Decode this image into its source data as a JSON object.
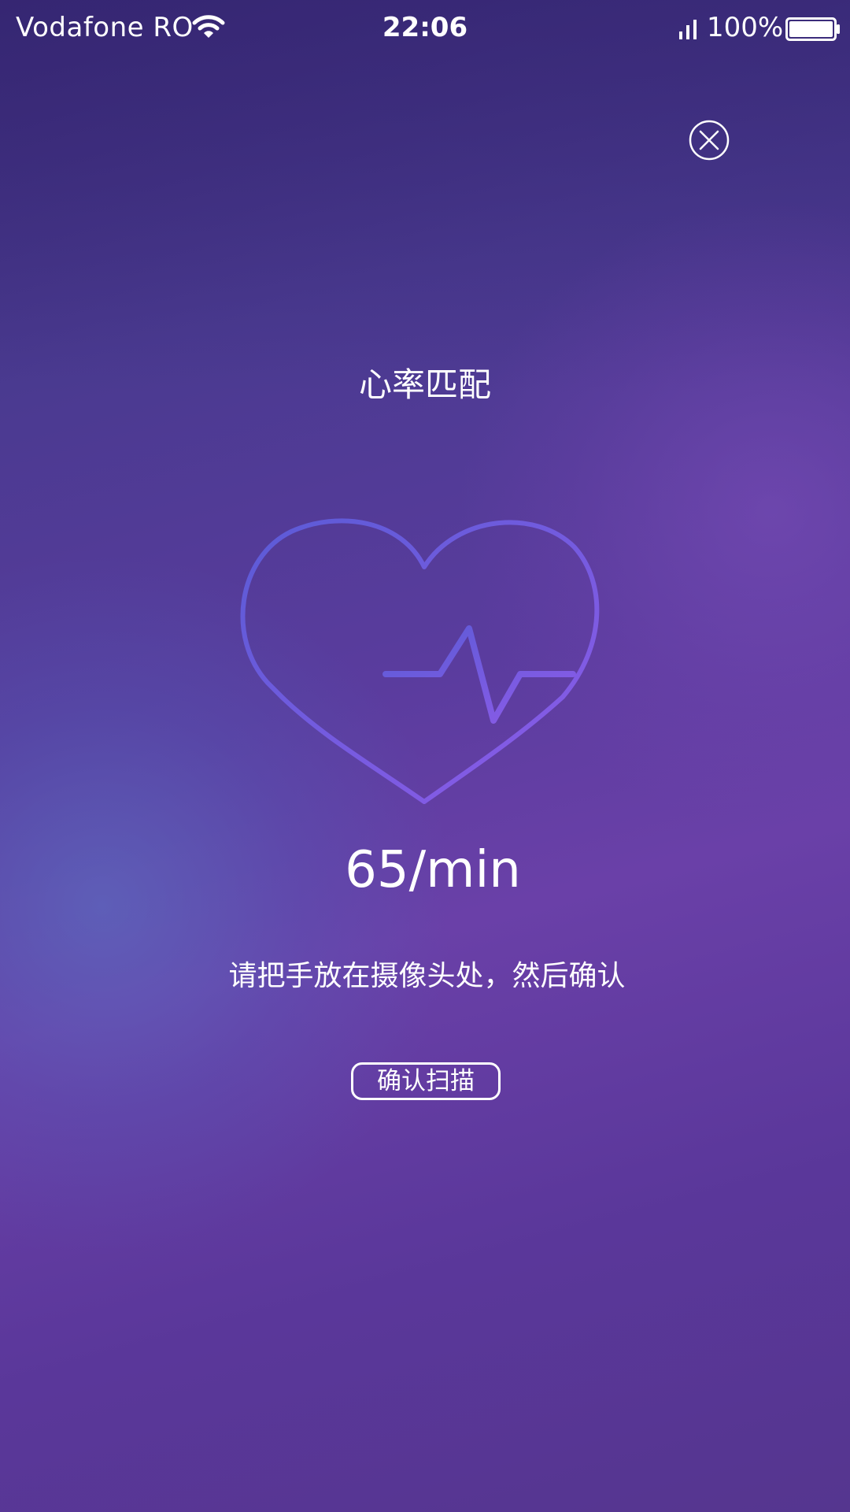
{
  "status_bar": {
    "carrier": "Vodafone RO",
    "time": "22:06",
    "battery_percent": "100%",
    "icons": [
      "wifi-icon",
      "signal-icon",
      "battery-icon"
    ]
  },
  "close_icon": "close-circle-icon",
  "title": "心率匹配",
  "heart_icon": "heart-pulse-icon",
  "heart_rate": "65/min",
  "instruction": "请把手放在摄像头处，然后确认",
  "confirm_button_label": "确认扫描",
  "colors": {
    "background_top": "#3a2a78",
    "background_mid": "#6a40a8",
    "heart_stroke_start": "#5b5bd6",
    "heart_stroke_end": "#8d5be8",
    "text": "#ffffff"
  }
}
